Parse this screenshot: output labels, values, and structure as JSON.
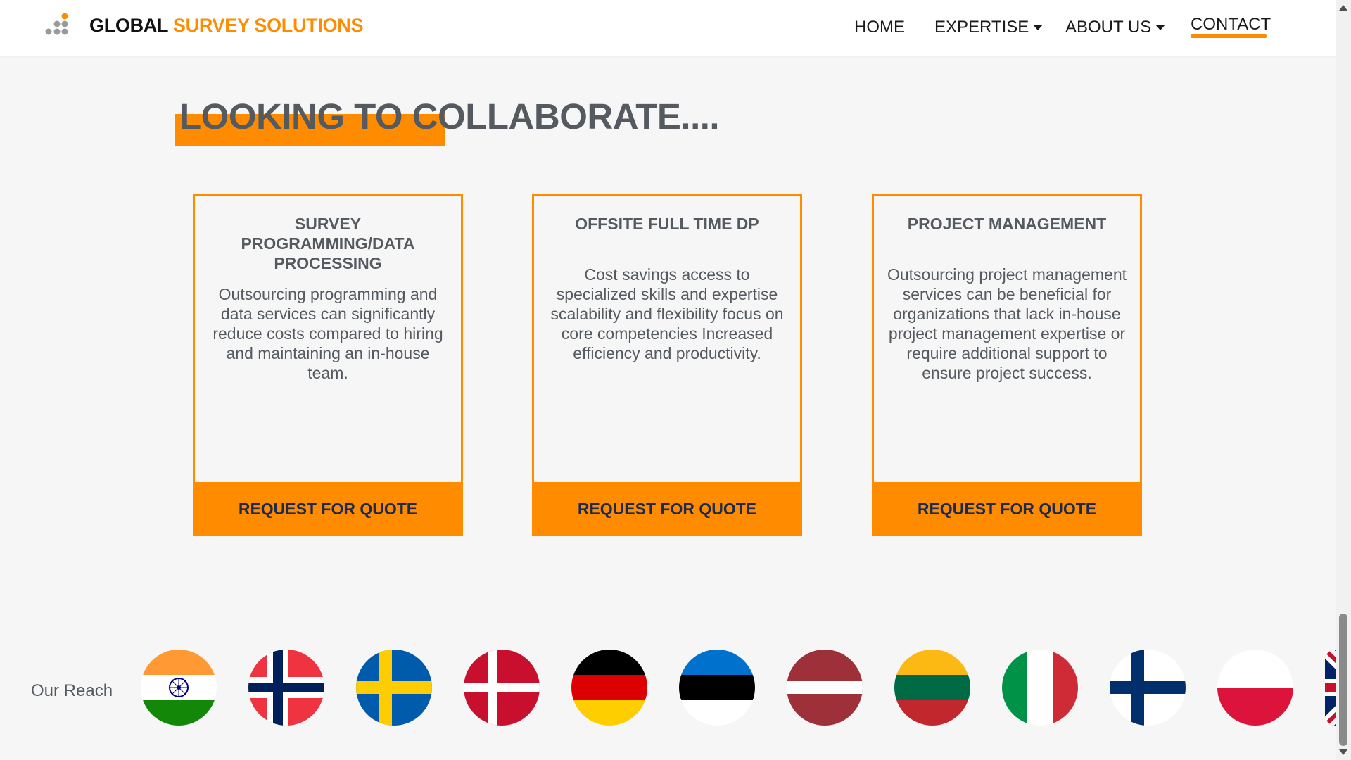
{
  "header": {
    "brand_part1": "GLOBAL",
    "brand_part2": "SURVEY SOLUTIONS",
    "nav": {
      "home": "HOME",
      "expertise": "EXPERTISE",
      "about": "ABOUT US",
      "contact": "CONTACT"
    }
  },
  "main": {
    "heading": "LOOKING TO COLLABORATE....",
    "cards": [
      {
        "title": "SURVEY PROGRAMMING/DATA PROCESSING",
        "text": "Outsourcing programming and data services can significantly reduce costs compared to hiring and maintaining an in-house team.",
        "button": "REQUEST FOR QUOTE"
      },
      {
        "title": "OFFSITE FULL TIME DP",
        "text": "Cost savings access to specialized skills and expertise scalability and flexibility focus on core competencies Increased efficiency and productivity.",
        "button": "REQUEST FOR QUOTE"
      },
      {
        "title": "PROJECT MANAGEMENT",
        "text": "Outsourcing project management services can be beneficial for organizations that lack in-house project management expertise or require additional support to ensure project success.",
        "button": "REQUEST FOR QUOTE"
      }
    ]
  },
  "reach": {
    "label": "Our Reach",
    "flags": [
      {
        "icon": "india-flag-icon"
      },
      {
        "icon": "norway-flag-icon"
      },
      {
        "icon": "sweden-flag-icon"
      },
      {
        "icon": "denmark-flag-icon"
      },
      {
        "icon": "germany-flag-icon"
      },
      {
        "icon": "estonia-flag-icon"
      },
      {
        "icon": "latvia-flag-icon"
      },
      {
        "icon": "lithuania-flag-icon"
      },
      {
        "icon": "italy-flag-icon"
      },
      {
        "icon": "finland-flag-icon"
      },
      {
        "icon": "poland-flag-icon"
      },
      {
        "icon": "united-kingdom-flag-icon"
      }
    ]
  },
  "colors": {
    "accent": "#ff8c00",
    "heading_text": "#555a60",
    "button_text": "#1d2a4d",
    "background": "#f6f6f6"
  }
}
